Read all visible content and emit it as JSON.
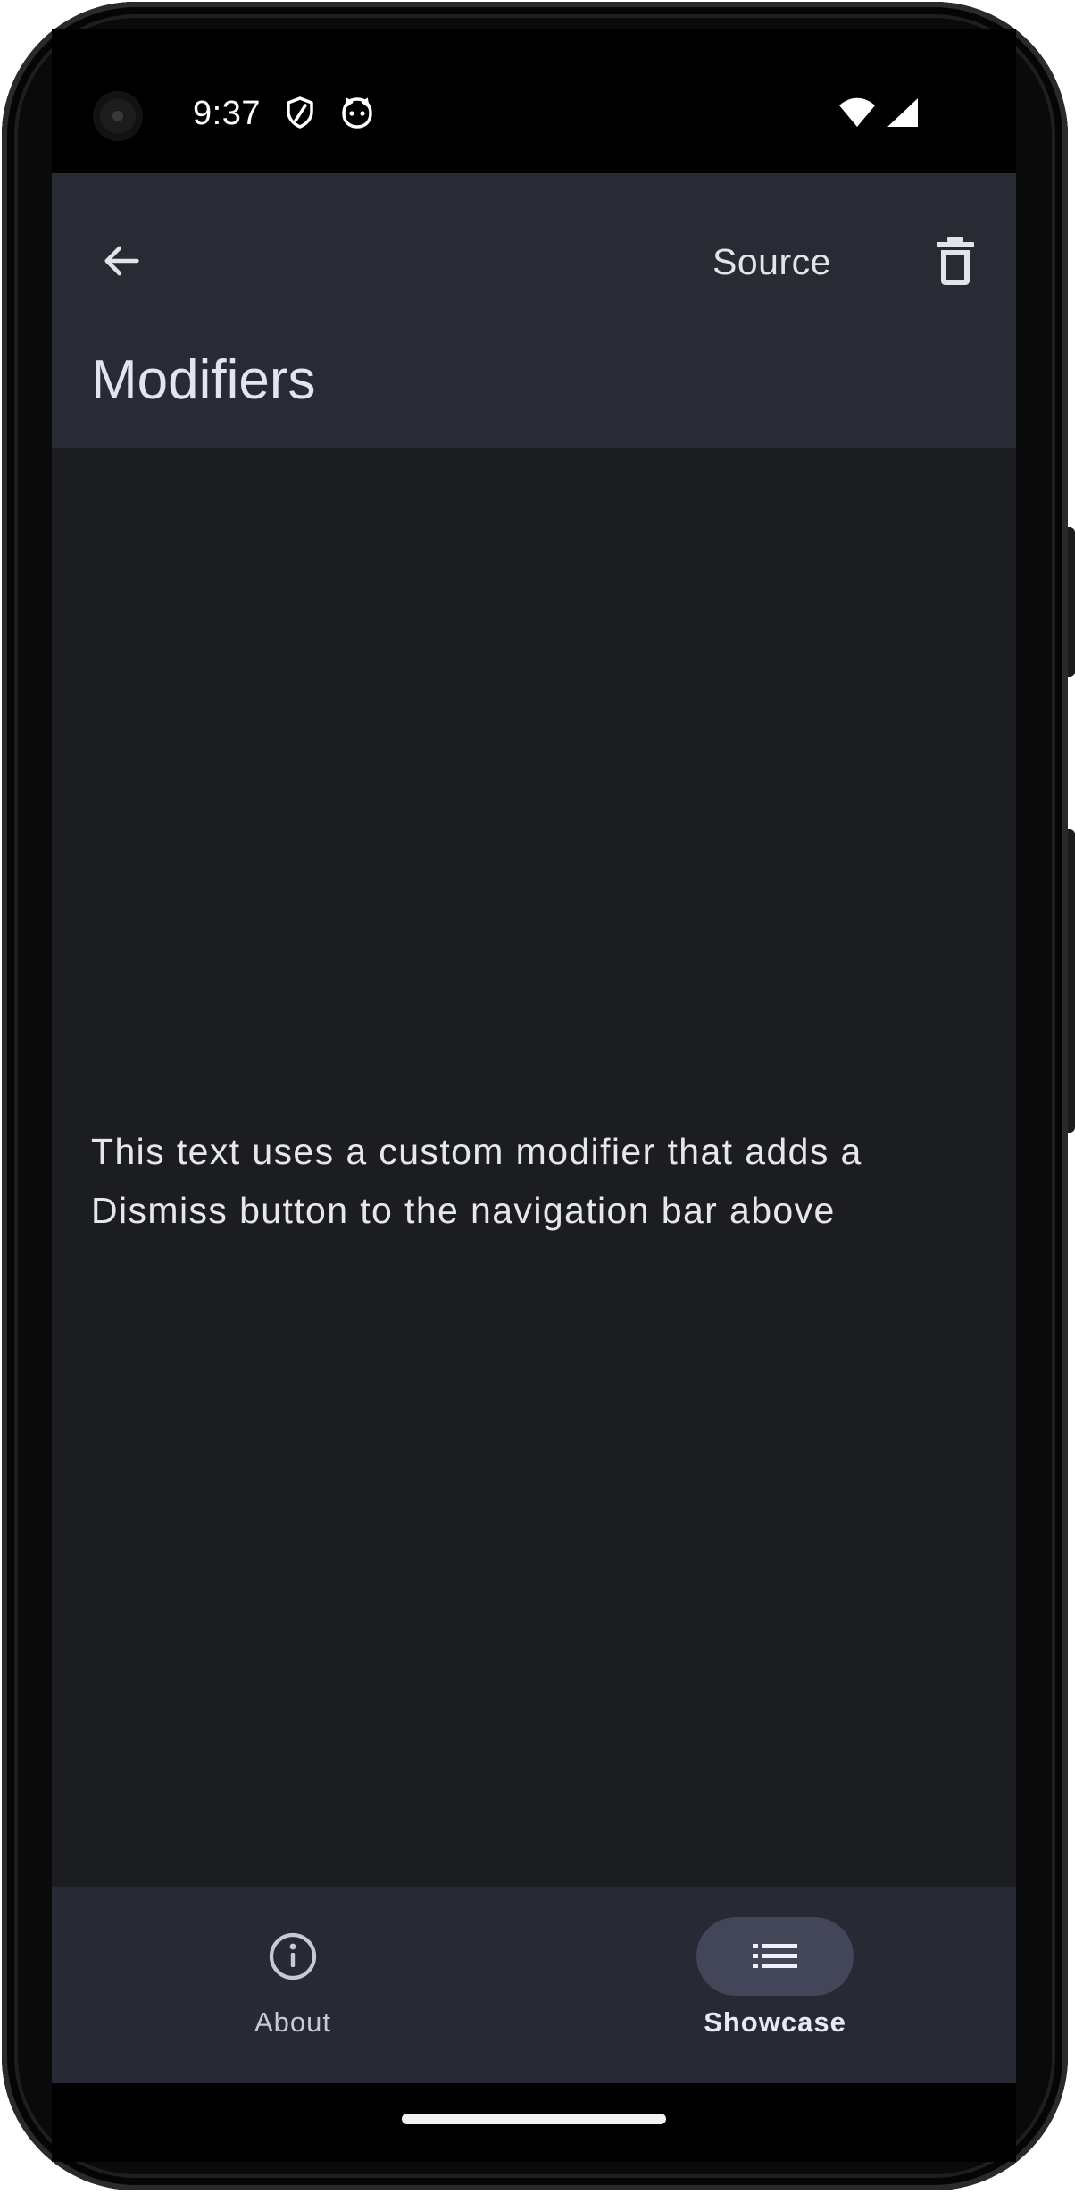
{
  "status_bar": {
    "time": "9:37",
    "left_icons": [
      "shield-icon",
      "cat-face-icon"
    ],
    "right_icons": [
      "wifi-icon",
      "cellular-signal-icon"
    ]
  },
  "app_bar": {
    "back_icon": "arrow-left-icon",
    "source_label": "Source",
    "delete_icon": "trash-icon",
    "title": "Modifiers"
  },
  "content": {
    "text": "This text uses a custom modifier that adds a Dismiss button to the navigation bar above"
  },
  "bottom_nav": {
    "items": [
      {
        "label": "About",
        "icon": "info-circle-icon",
        "selected": false
      },
      {
        "label": "Showcase",
        "icon": "list-icon",
        "selected": true
      }
    ]
  },
  "colors": {
    "app_bar_bg": "#282a34",
    "content_bg": "#1c1d21",
    "bottom_nav_bg": "#272a35",
    "selected_indicator": "#434658",
    "text_primary": "#e4e4ee"
  }
}
